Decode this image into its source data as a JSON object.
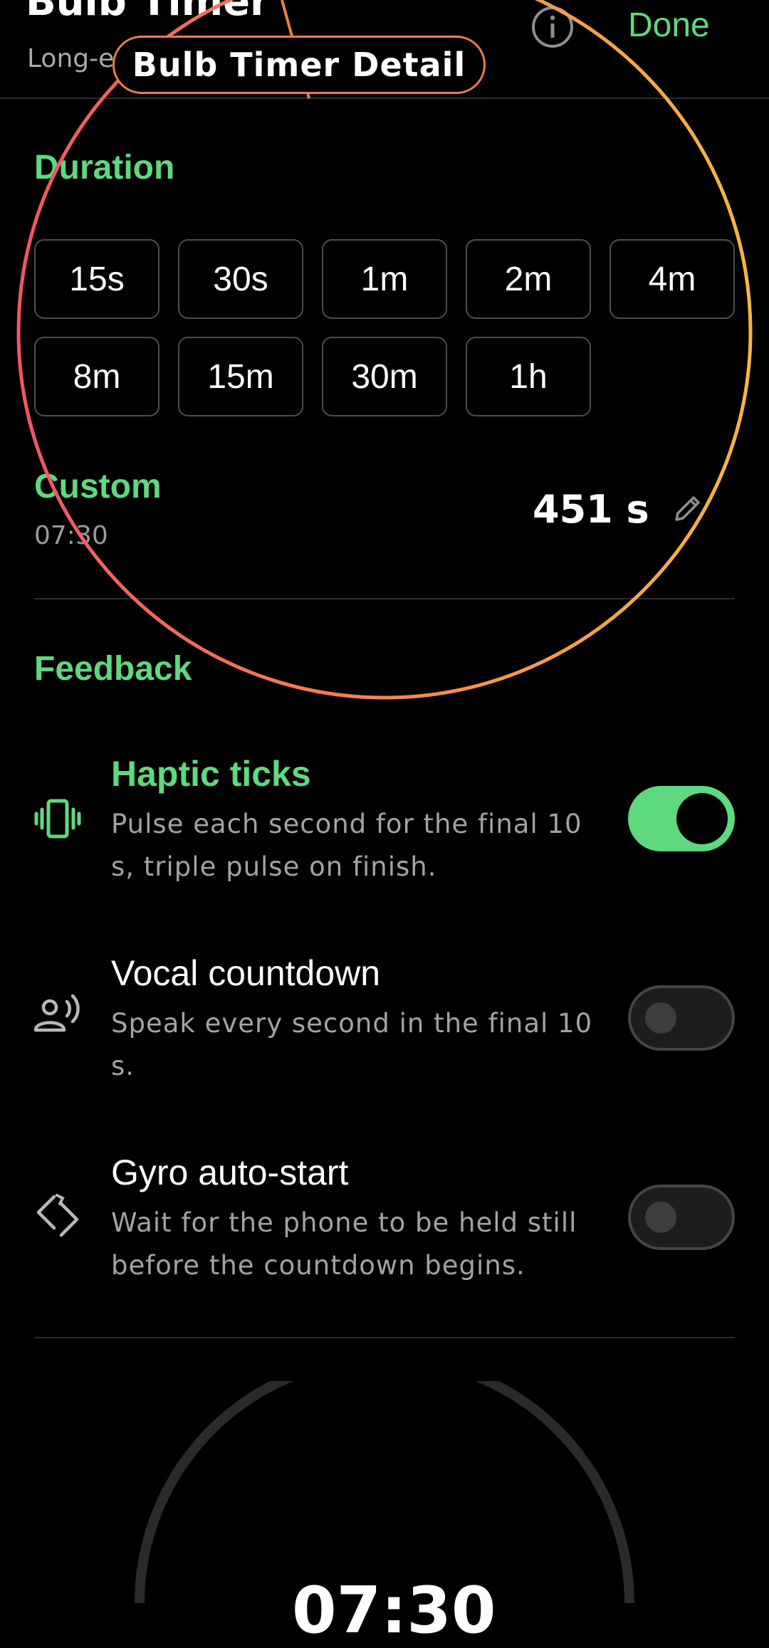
{
  "header": {
    "title": "Bulb Timer",
    "subtitle": "Long-e",
    "done_label": "Done",
    "info_icon": "info-icon"
  },
  "duration": {
    "heading": "Duration",
    "chips": [
      "15s",
      "30s",
      "1m",
      "2m",
      "4m",
      "8m",
      "15m",
      "30m",
      "1h"
    ],
    "custom": {
      "label": "Custom",
      "time": "07:30",
      "value": "451 s",
      "edit_icon": "pencil-icon"
    }
  },
  "feedback": {
    "heading": "Feedback",
    "items": [
      {
        "title": "Haptic ticks",
        "description": "Pulse each second for the final 10 s, triple pulse on finish.",
        "icon": "vibration-icon",
        "enabled": true
      },
      {
        "title": "Vocal countdown",
        "description": "Speak every second in the final 10 s.",
        "icon": "voice-icon",
        "enabled": false
      },
      {
        "title": "Gyro auto-start",
        "description": "Wait for the phone to be held still before the countdown begins.",
        "icon": "rotate-icon",
        "enabled": false
      }
    ]
  },
  "timer": {
    "display": "07:30"
  },
  "overlay": {
    "label": "Bulb Timer Detail"
  },
  "colors": {
    "accent": "#5fd97e",
    "background": "#000000",
    "muted_text": "#a3a3a3",
    "overlay_ring_start": "#f25565",
    "overlay_ring_end": "#f7b642"
  }
}
